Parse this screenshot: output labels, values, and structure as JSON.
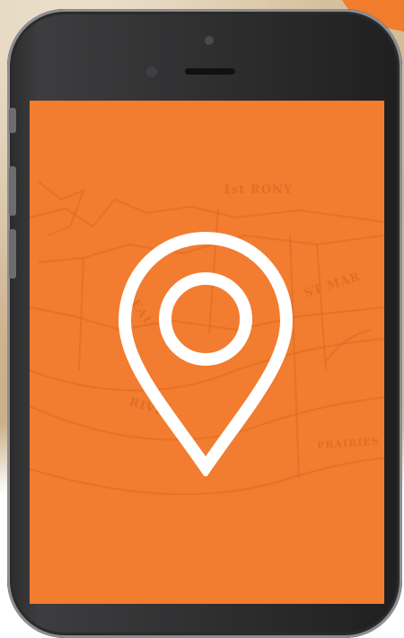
{
  "page": {
    "accent_color": "#f27c2f",
    "phone_color": "#2a2a2b"
  },
  "map": {
    "labels": [
      "1st RONY",
      "ST MAR",
      "EAU",
      "RIVIE",
      "PRAIRIES"
    ]
  },
  "icons": {
    "center": "location-pin-icon"
  }
}
